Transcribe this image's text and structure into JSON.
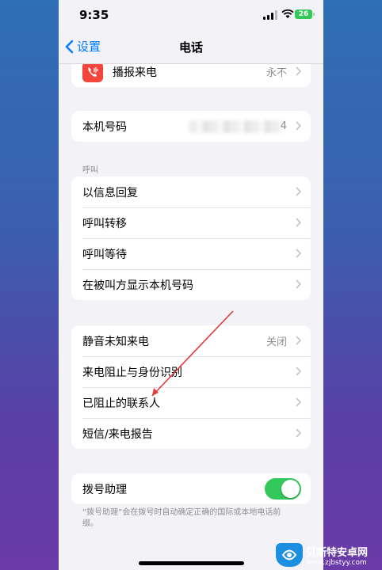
{
  "status": {
    "time": "9:35",
    "battery": "26"
  },
  "nav": {
    "back_label": "设置",
    "title": "电话"
  },
  "top_row": {
    "label": "播报来电",
    "value": "永不"
  },
  "my_number": {
    "label": "本机号码",
    "value_suffix": "4"
  },
  "calls_section": {
    "header": "呼叫",
    "items": [
      "以信息回复",
      "呼叫转移",
      "呼叫等待",
      "在被叫方显示本机号码"
    ]
  },
  "blocking_section": {
    "items": [
      {
        "label": "静音未知来电",
        "value": "关闭"
      },
      {
        "label": "来电阻止与身份识别",
        "value": ""
      },
      {
        "label": "已阻止的联系人",
        "value": ""
      },
      {
        "label": "短信/来电报告",
        "value": ""
      }
    ]
  },
  "dial_assist": {
    "label": "拨号助理",
    "enabled": true,
    "footnote": "“拨号助理”会在拨号时自动确定正确的国际或本地电话前缀。"
  },
  "watermark": {
    "name": "贝斯特安卓网",
    "url": "www.zjbstyy.com"
  },
  "colors": {
    "accent": "#007aff",
    "toggle_on": "#34c759",
    "annotation": "#e03a3a",
    "phone_icon": "#f2463c"
  }
}
